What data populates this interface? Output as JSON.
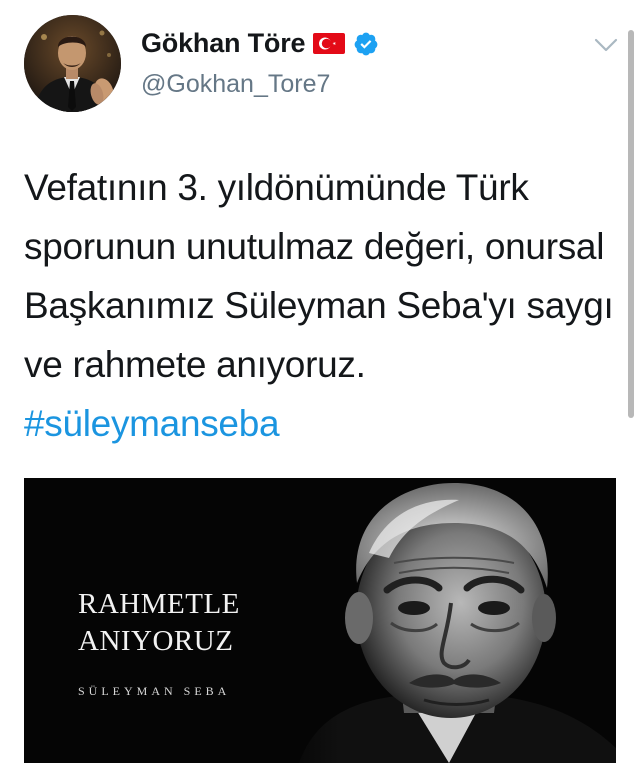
{
  "tweet": {
    "author": {
      "display_name": "Gökhan Töre",
      "handle": "@Gokhan_Tore7",
      "avatar_icon": "profile-photo",
      "flag_icon": "turkey-flag-emoji",
      "verified_icon": "verified-badge-icon"
    },
    "menu_icon": "chevron-down-icon",
    "text": {
      "body": "Vefatının 3. yıldönümünde Türk sporunun unutulmaz değeri, onursal Başkanımız Süleyman Seba'yı saygı ve rahmete anıyoruz. ",
      "hashtag": "#süleymanseba"
    },
    "media": {
      "headline_line1": "RAHMETLE",
      "headline_line2": "ANIYORUZ",
      "subtitle": "SÜLEYMAN SEBA"
    }
  },
  "colors": {
    "hashtag": "#1b95e0",
    "verified": "#1da1f2",
    "handle": "#657786",
    "text": "#14171a",
    "flag_red": "#e30a17"
  }
}
